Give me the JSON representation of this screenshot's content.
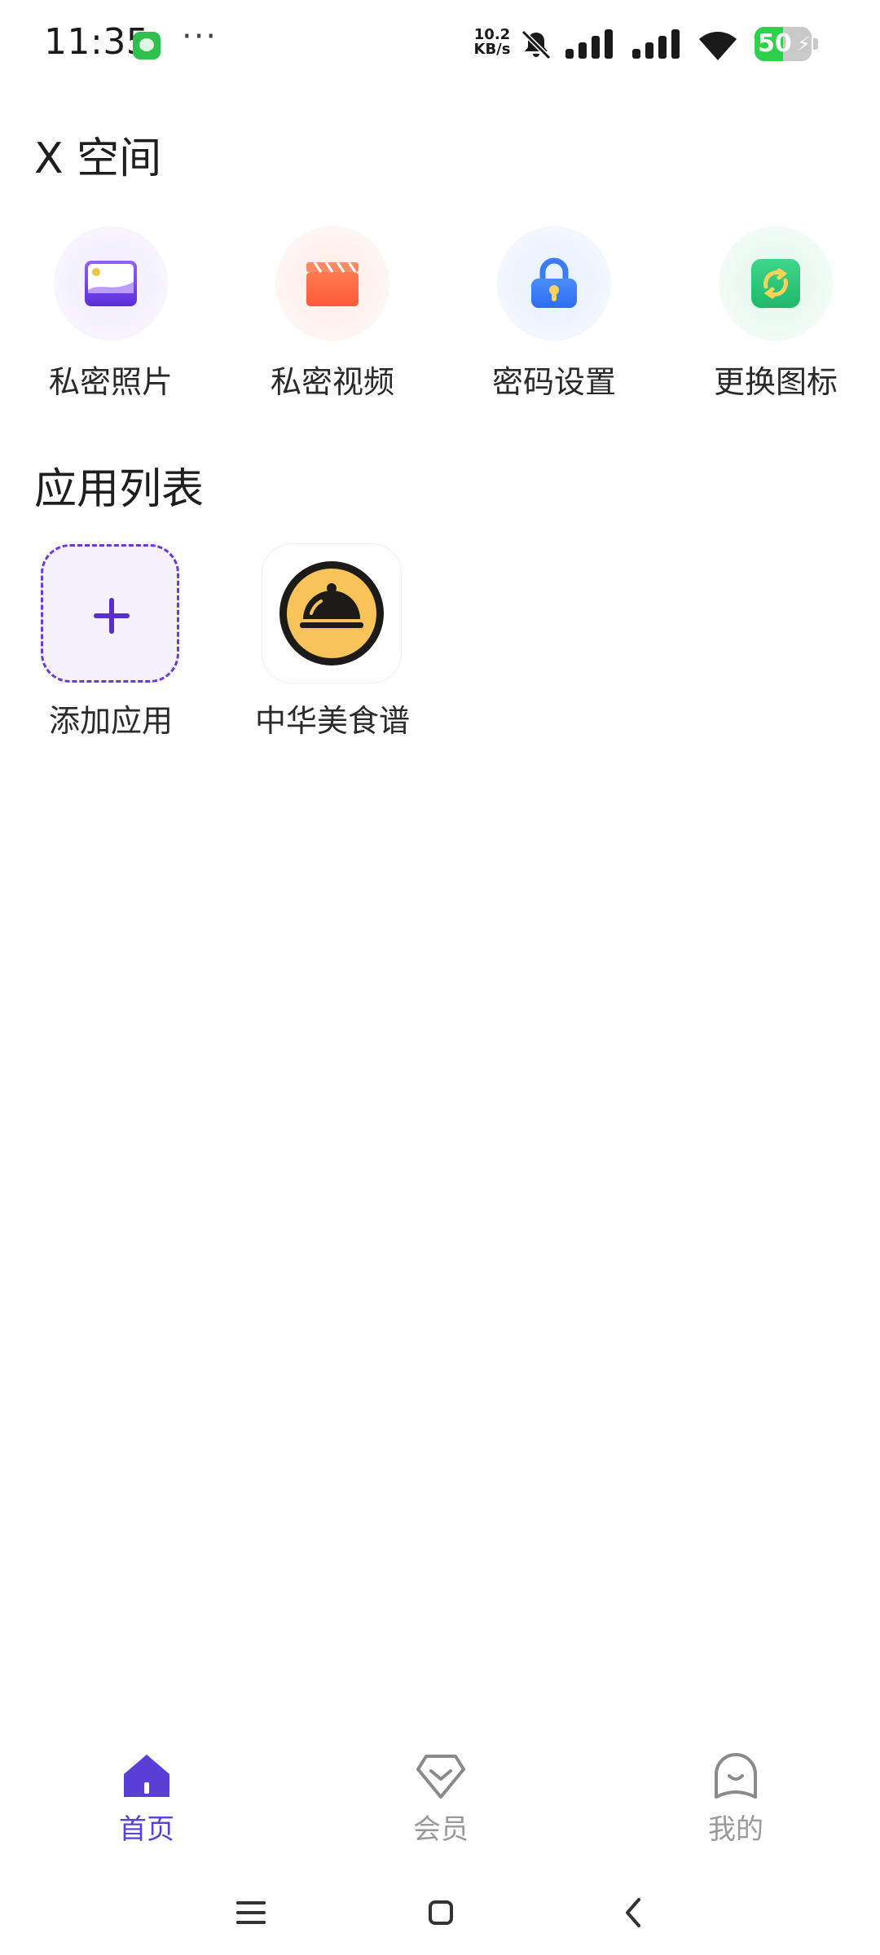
{
  "status_bar": {
    "time": "11:35",
    "more": "···",
    "net_speed_value": "10.2",
    "net_speed_unit": "KB/s",
    "battery_level": "50",
    "icons": [
      "message-icon",
      "bell-off-icon",
      "signal-icon",
      "signal-icon",
      "wifi-icon",
      "battery-charging-icon"
    ]
  },
  "header": {
    "title": "X 空间"
  },
  "features": [
    {
      "label": "私密照片",
      "icon": "photo-icon"
    },
    {
      "label": "私密视频",
      "icon": "video-icon"
    },
    {
      "label": "密码设置",
      "icon": "lock-icon"
    },
    {
      "label": "更换图标",
      "icon": "swap-icon"
    }
  ],
  "apps_section": {
    "title": "应用列表",
    "items": [
      {
        "label": "添加应用",
        "icon": "plus-icon"
      },
      {
        "label": "中华美食谱",
        "icon": "food-cloche-icon"
      }
    ]
  },
  "bottom_nav": {
    "items": [
      {
        "label": "首页",
        "icon": "home-icon",
        "active": true
      },
      {
        "label": "会员",
        "icon": "diamond-icon",
        "active": false
      },
      {
        "label": "我的",
        "icon": "profile-icon",
        "active": false
      }
    ]
  },
  "colors": {
    "accent": "#5a3fd6",
    "inactive": "#9a9a9a",
    "battery": "#2fd04a"
  }
}
